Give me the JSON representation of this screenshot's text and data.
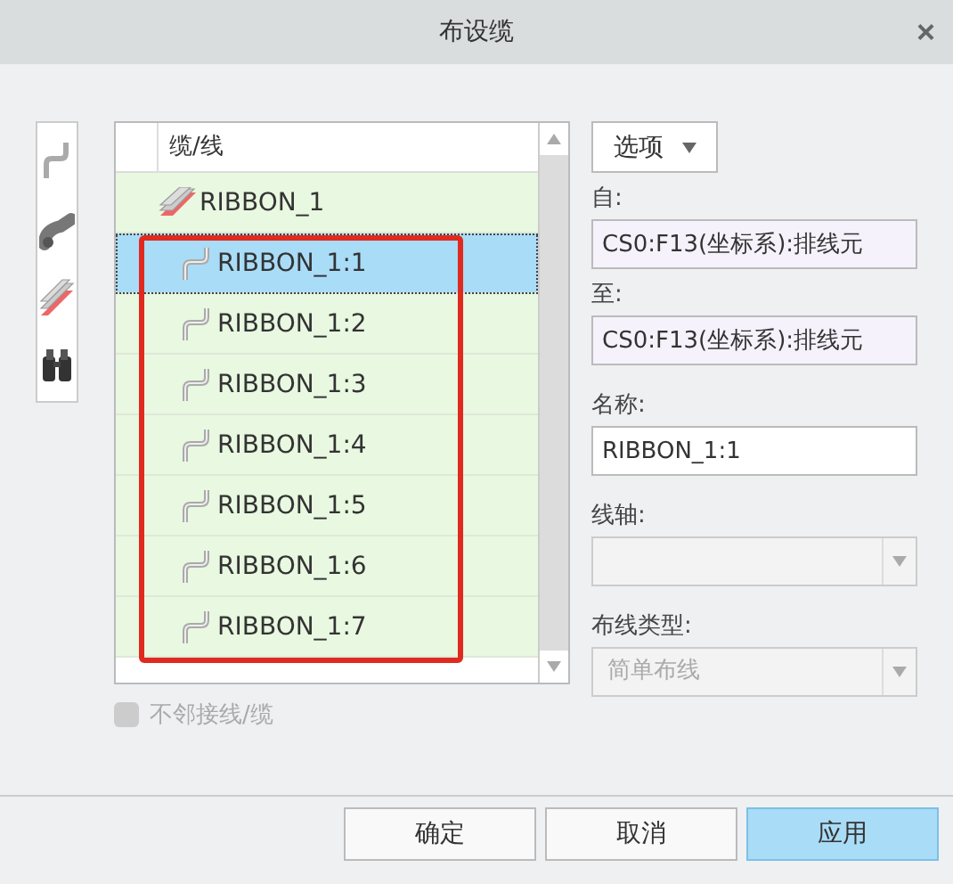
{
  "window": {
    "title": "布设缆",
    "close": "×"
  },
  "tree": {
    "column_header": "缆/线",
    "rows": [
      {
        "label": "RIBBON_1",
        "kind": "cable",
        "selected": false,
        "children": [
          {
            "label": "RIBBON_1:1",
            "kind": "wire",
            "selected": true
          },
          {
            "label": "RIBBON_1:2",
            "kind": "wire",
            "selected": false
          },
          {
            "label": "RIBBON_1:3",
            "kind": "wire",
            "selected": false
          },
          {
            "label": "RIBBON_1:4",
            "kind": "wire",
            "selected": false
          },
          {
            "label": "RIBBON_1:5",
            "kind": "wire",
            "selected": false
          },
          {
            "label": "RIBBON_1:6",
            "kind": "wire",
            "selected": false
          },
          {
            "label": "RIBBON_1:7",
            "kind": "wire",
            "selected": false
          }
        ]
      }
    ]
  },
  "add_item": {
    "label": "不邻接线/缆",
    "disabled": true
  },
  "options_button": {
    "label": "选项"
  },
  "fields": [
    {
      "label": "自:",
      "kind": "readonly",
      "value": "CS0:F13(坐标系):排线元"
    },
    {
      "label": "至:",
      "kind": "readonly",
      "value": "CS0:F13(坐标系):排线元"
    },
    {
      "label": "名称:",
      "kind": "text",
      "value": "RIBBON_1:1"
    },
    {
      "label": "线轴:",
      "kind": "dropdown",
      "disabled": true
    },
    {
      "label": "布线类型:",
      "kind": "dropdown",
      "value": "简单布线",
      "disabled": true
    }
  ],
  "buttons": [
    {
      "label": "确定",
      "selected": false
    },
    {
      "label": "取消",
      "selected": false
    },
    {
      "label": "应用",
      "selected": true
    }
  ]
}
